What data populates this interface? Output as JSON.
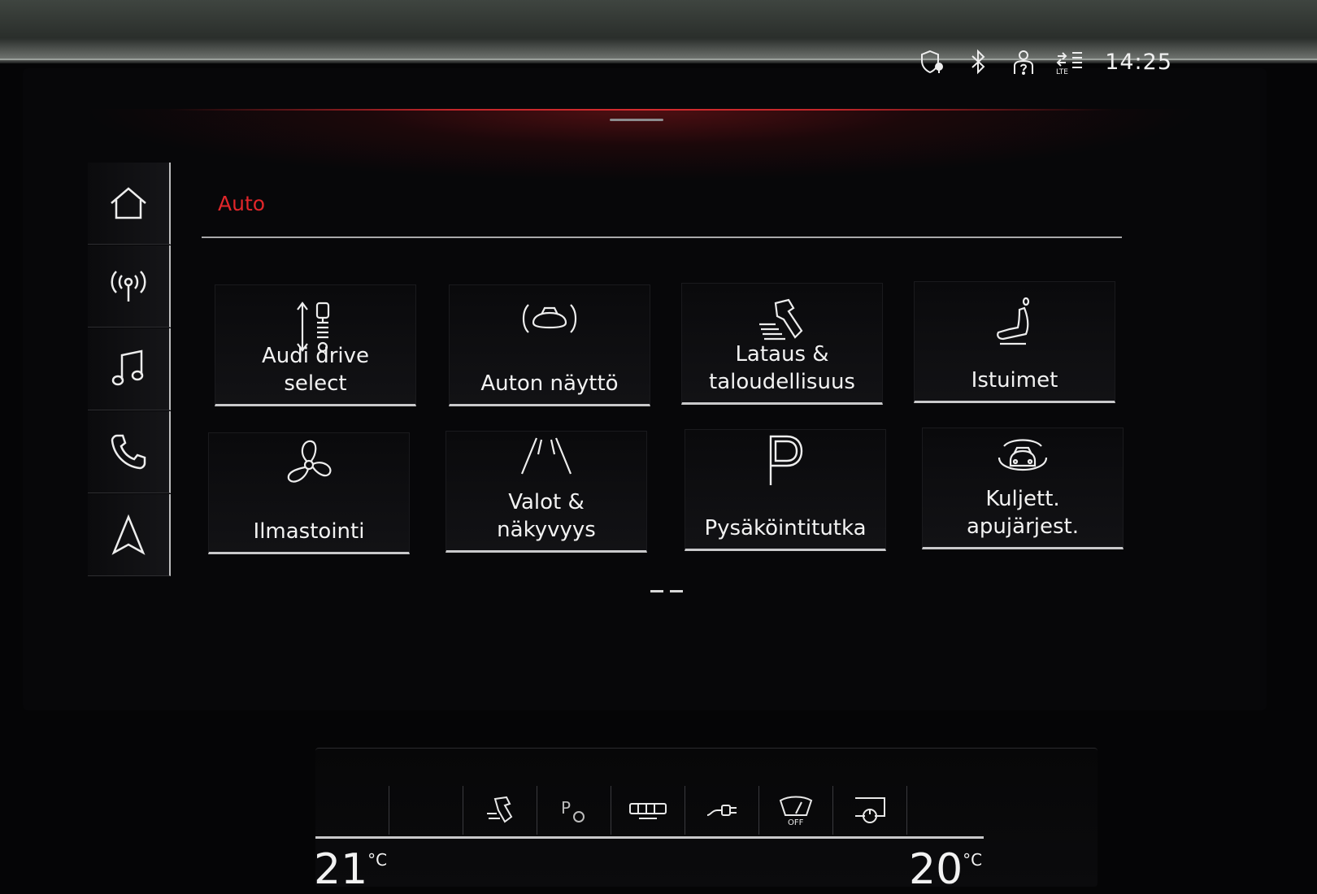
{
  "status_bar": {
    "clock": "14:25",
    "icons": [
      "shield-location-icon",
      "bluetooth-icon",
      "user-help-icon",
      "lte-signal-icon"
    ],
    "lte_label": "LTE"
  },
  "nav_rail": {
    "items": [
      {
        "name": "home",
        "icon": "home-icon"
      },
      {
        "name": "radio",
        "icon": "radio-antenna-icon"
      },
      {
        "name": "media",
        "icon": "music-note-icon"
      },
      {
        "name": "phone",
        "icon": "phone-icon"
      },
      {
        "name": "navigation",
        "icon": "navigation-arrow-icon"
      }
    ]
  },
  "page": {
    "title": "Auto",
    "accent_color": "#e0262a"
  },
  "tiles": [
    {
      "label": "Audi drive\nselect",
      "icon": "drive-select-icon"
    },
    {
      "label": "Auton näyttö",
      "icon": "car-display-icon"
    },
    {
      "label": "Lataus &\ntaloudellisuus",
      "icon": "charging-efficiency-icon"
    },
    {
      "label": "Istuimet",
      "icon": "seat-icon"
    },
    {
      "label": "Ilmastointi",
      "icon": "fan-icon"
    },
    {
      "label": "Valot &\nnäkyvyys",
      "icon": "lights-road-icon"
    },
    {
      "label": "Pysäköintitutka",
      "icon": "parking-icon"
    },
    {
      "label": "Kuljett.\napujärjest.",
      "icon": "driver-assist-icon"
    }
  ],
  "pager": {
    "pages": 2,
    "current": 1
  },
  "climate": {
    "buttons": [
      "blank",
      "blank",
      "seat-heat-icon",
      "park-assist-icon",
      "rear-defrost-icon",
      "charge-plug-icon",
      "windshield-off-icon",
      "power-screen-icon",
      "blank"
    ],
    "off_label": "OFF",
    "park_label": "P",
    "left_temp": "21",
    "right_temp": "20",
    "unit": "°C"
  }
}
